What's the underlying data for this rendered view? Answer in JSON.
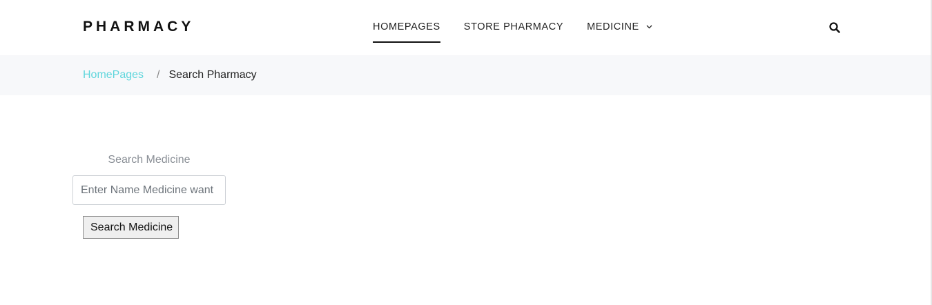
{
  "header": {
    "logo": "PHARMACY",
    "nav": [
      {
        "label": "HOMEPAGES",
        "active": true
      },
      {
        "label": "STORE PHARMACY",
        "active": false
      },
      {
        "label": "MEDICINE",
        "active": false
      }
    ],
    "search_icon": "search-icon"
  },
  "breadcrumb": {
    "home": "HomePages",
    "separator": "/",
    "current": "Search Pharmacy"
  },
  "form": {
    "label": "Search Medicine",
    "input_value": "",
    "input_placeholder": "Enter Name Medicine want",
    "button_label": "Search Medicine"
  },
  "colors": {
    "accent": "#5fd6dc",
    "breadcrumb_bg": "#f7f8fa"
  }
}
